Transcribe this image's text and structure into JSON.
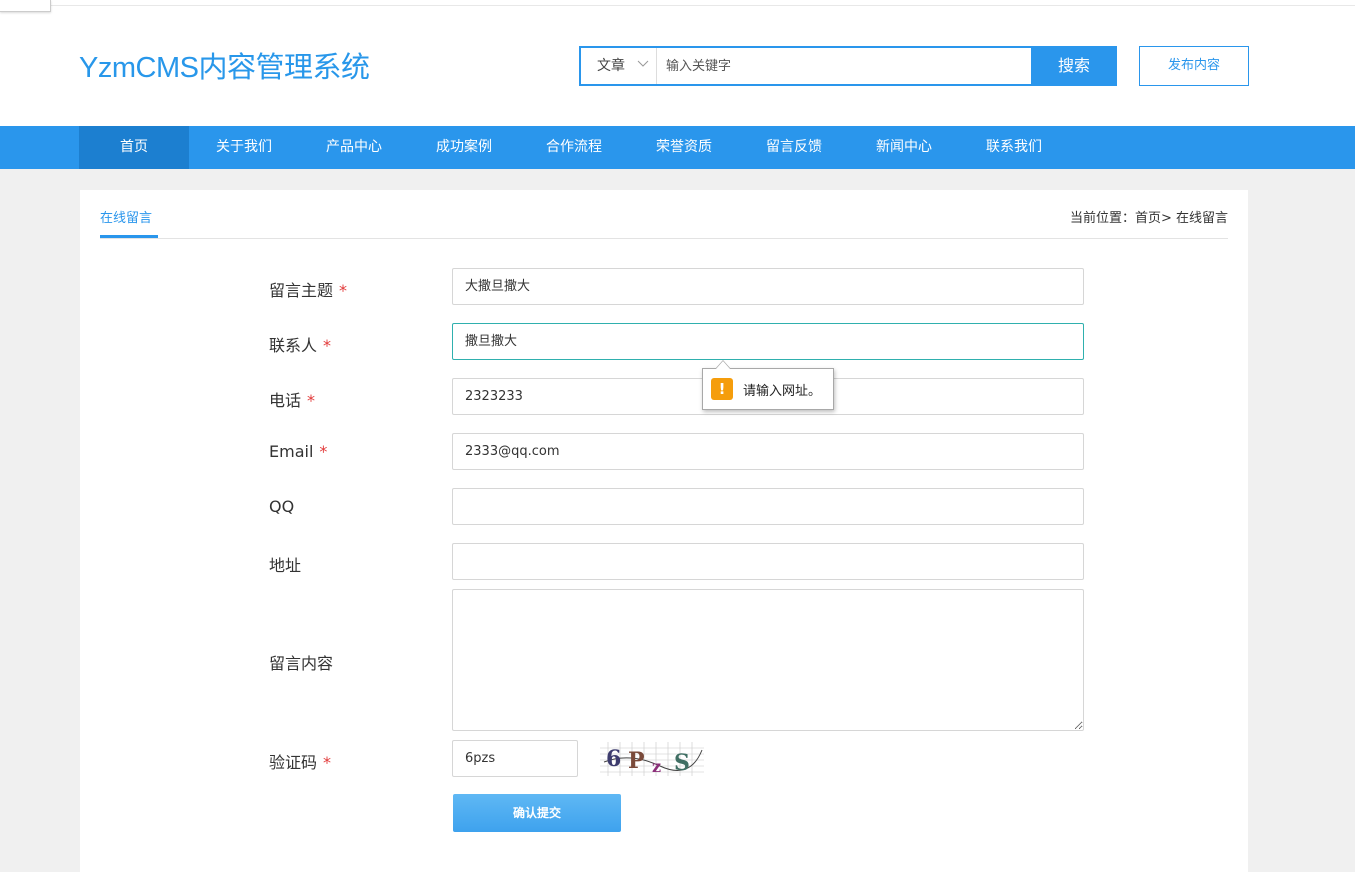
{
  "header": {
    "logo": "YzmCMS内容管理系统",
    "search": {
      "type_label": "文章",
      "placeholder": "输入关键字",
      "button_label": "搜索"
    },
    "publish_label": "发布内容"
  },
  "nav": {
    "items": [
      "首页",
      "关于我们",
      "产品中心",
      "成功案例",
      "合作流程",
      "荣誉资质",
      "留言反馈",
      "新闻中心",
      "联系我们"
    ],
    "active_index": 0
  },
  "page": {
    "tab_title": "在线留言",
    "breadcrumb": "当前位置：首页> 在线留言"
  },
  "form": {
    "required_mark": "*",
    "fields": [
      {
        "label": "留言主题",
        "required": true,
        "value": "大撒旦撒大"
      },
      {
        "label": "联系人",
        "required": true,
        "value": "撒旦撒大"
      },
      {
        "label": "电话",
        "required": true,
        "value": "2323233"
      },
      {
        "label": "Email",
        "required": true,
        "value": "2333@qq.com"
      },
      {
        "label": "QQ",
        "required": false,
        "value": ""
      },
      {
        "label": "地址",
        "required": false,
        "value": ""
      },
      {
        "label": "留言内容",
        "required": false,
        "value": ""
      },
      {
        "label": "验证码",
        "required": true,
        "value": "6pzs"
      }
    ],
    "captcha_text": "6PzS",
    "submit_label": "确认提交"
  },
  "validation_tooltip": {
    "icon": "warning-icon",
    "text": "请输入网址。"
  },
  "colors": {
    "accent": "#2a96ec",
    "nav_active": "#1c7fd0",
    "required": "#e23a3a",
    "warning": "#f59d0c"
  }
}
